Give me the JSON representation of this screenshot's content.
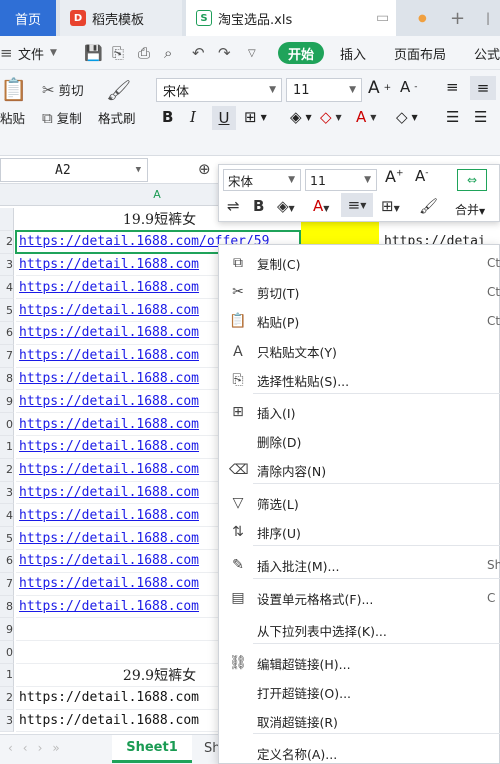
{
  "tabs": {
    "home": "首页",
    "daoke": "稻壳模板",
    "file": "淘宝选品.xls",
    "close": "×"
  },
  "menu": {
    "file": "文件",
    "start": "开始",
    "insert": "插入",
    "page_layout": "页面布局",
    "formula": "公式"
  },
  "ribbon": {
    "paste": "粘贴",
    "cut": "剪切",
    "copy": "复制",
    "format_painter": "格式刷",
    "font": "宋体",
    "size": "11"
  },
  "namebox": "A2",
  "grid": {
    "col_a": "A",
    "rows": [
      {
        "num": "",
        "text": "19.9短裤女",
        "kind": "title"
      },
      {
        "num": "2",
        "text": "https://detail.1688.com/offer/59",
        "kind": "link"
      },
      {
        "num": "3",
        "text": "https://detail.1688.com",
        "kind": "link"
      },
      {
        "num": "4",
        "text": "https://detail.1688.com",
        "kind": "link"
      },
      {
        "num": "5",
        "text": "https://detail.1688.com",
        "kind": "link"
      },
      {
        "num": "6",
        "text": "https://detail.1688.com",
        "kind": "link"
      },
      {
        "num": "7",
        "text": "https://detail.1688.com",
        "kind": "link"
      },
      {
        "num": "8",
        "text": "https://detail.1688.com",
        "kind": "link"
      },
      {
        "num": "9",
        "text": "https://detail.1688.com",
        "kind": "link"
      },
      {
        "num": "0",
        "text": "https://detail.1688.com",
        "kind": "link"
      },
      {
        "num": "1",
        "text": "https://detail.1688.com",
        "kind": "link"
      },
      {
        "num": "2",
        "text": "https://detail.1688.com",
        "kind": "link"
      },
      {
        "num": "3",
        "text": "https://detail.1688.com",
        "kind": "link"
      },
      {
        "num": "4",
        "text": "https://detail.1688.com",
        "kind": "link"
      },
      {
        "num": "5",
        "text": "https://detail.1688.com",
        "kind": "link"
      },
      {
        "num": "6",
        "text": "https://detail.1688.com",
        "kind": "link"
      },
      {
        "num": "7",
        "text": "https://detail.1688.com",
        "kind": "link"
      },
      {
        "num": "8",
        "text": "https://detail.1688.com",
        "kind": "link"
      },
      {
        "num": "9",
        "text": "",
        "kind": "plain"
      },
      {
        "num": "0",
        "text": "",
        "kind": "plain"
      },
      {
        "num": "1",
        "text": "29.9短裤女",
        "kind": "title"
      },
      {
        "num": "2",
        "text": "https://detail.1688.com",
        "kind": "plain"
      },
      {
        "num": "3",
        "text": "https://detail.1688.com",
        "kind": "plain"
      }
    ],
    "col_c_row2": "https://detai"
  },
  "sheet": {
    "active": "Sheet1",
    "next": "Sh"
  },
  "mini": {
    "font": "宋体",
    "size": "11",
    "merge": "合并"
  },
  "context_menu": [
    {
      "icon": "copy-icon",
      "label": "复制(C)",
      "key": "Ct"
    },
    {
      "icon": "cut-icon",
      "label": "剪切(T)",
      "key": "Ct"
    },
    {
      "icon": "paste-icon",
      "label": "粘贴(P)",
      "key": "Ct"
    },
    {
      "icon": "paste-text-icon",
      "label": "只粘贴文本(Y)",
      "key": ""
    },
    {
      "icon": "paste-special-icon",
      "label": "选择性粘贴(S)...",
      "key": ""
    },
    {
      "icon": "insert-icon",
      "label": "插入(I)",
      "key": ""
    },
    {
      "icon": "",
      "label": "删除(D)",
      "key": ""
    },
    {
      "icon": "clear-icon",
      "label": "清除内容(N)",
      "key": ""
    },
    {
      "icon": "filter-icon",
      "label": "筛选(L)",
      "key": ""
    },
    {
      "icon": "sort-icon",
      "label": "排序(U)",
      "key": ""
    },
    {
      "icon": "comment-icon",
      "label": "插入批注(M)...",
      "key": "Shif"
    },
    {
      "icon": "format-cells-icon",
      "label": "设置单元格格式(F)...",
      "key": "C"
    },
    {
      "icon": "",
      "label": "从下拉列表中选择(K)...",
      "key": ""
    },
    {
      "icon": "hyperlink-icon",
      "label": "编辑超链接(H)...",
      "key": ""
    },
    {
      "icon": "",
      "label": "打开超链接(O)...",
      "key": ""
    },
    {
      "icon": "",
      "label": "取消超链接(R)",
      "key": ""
    },
    {
      "icon": "",
      "label": "定义名称(A)...",
      "key": ""
    }
  ]
}
